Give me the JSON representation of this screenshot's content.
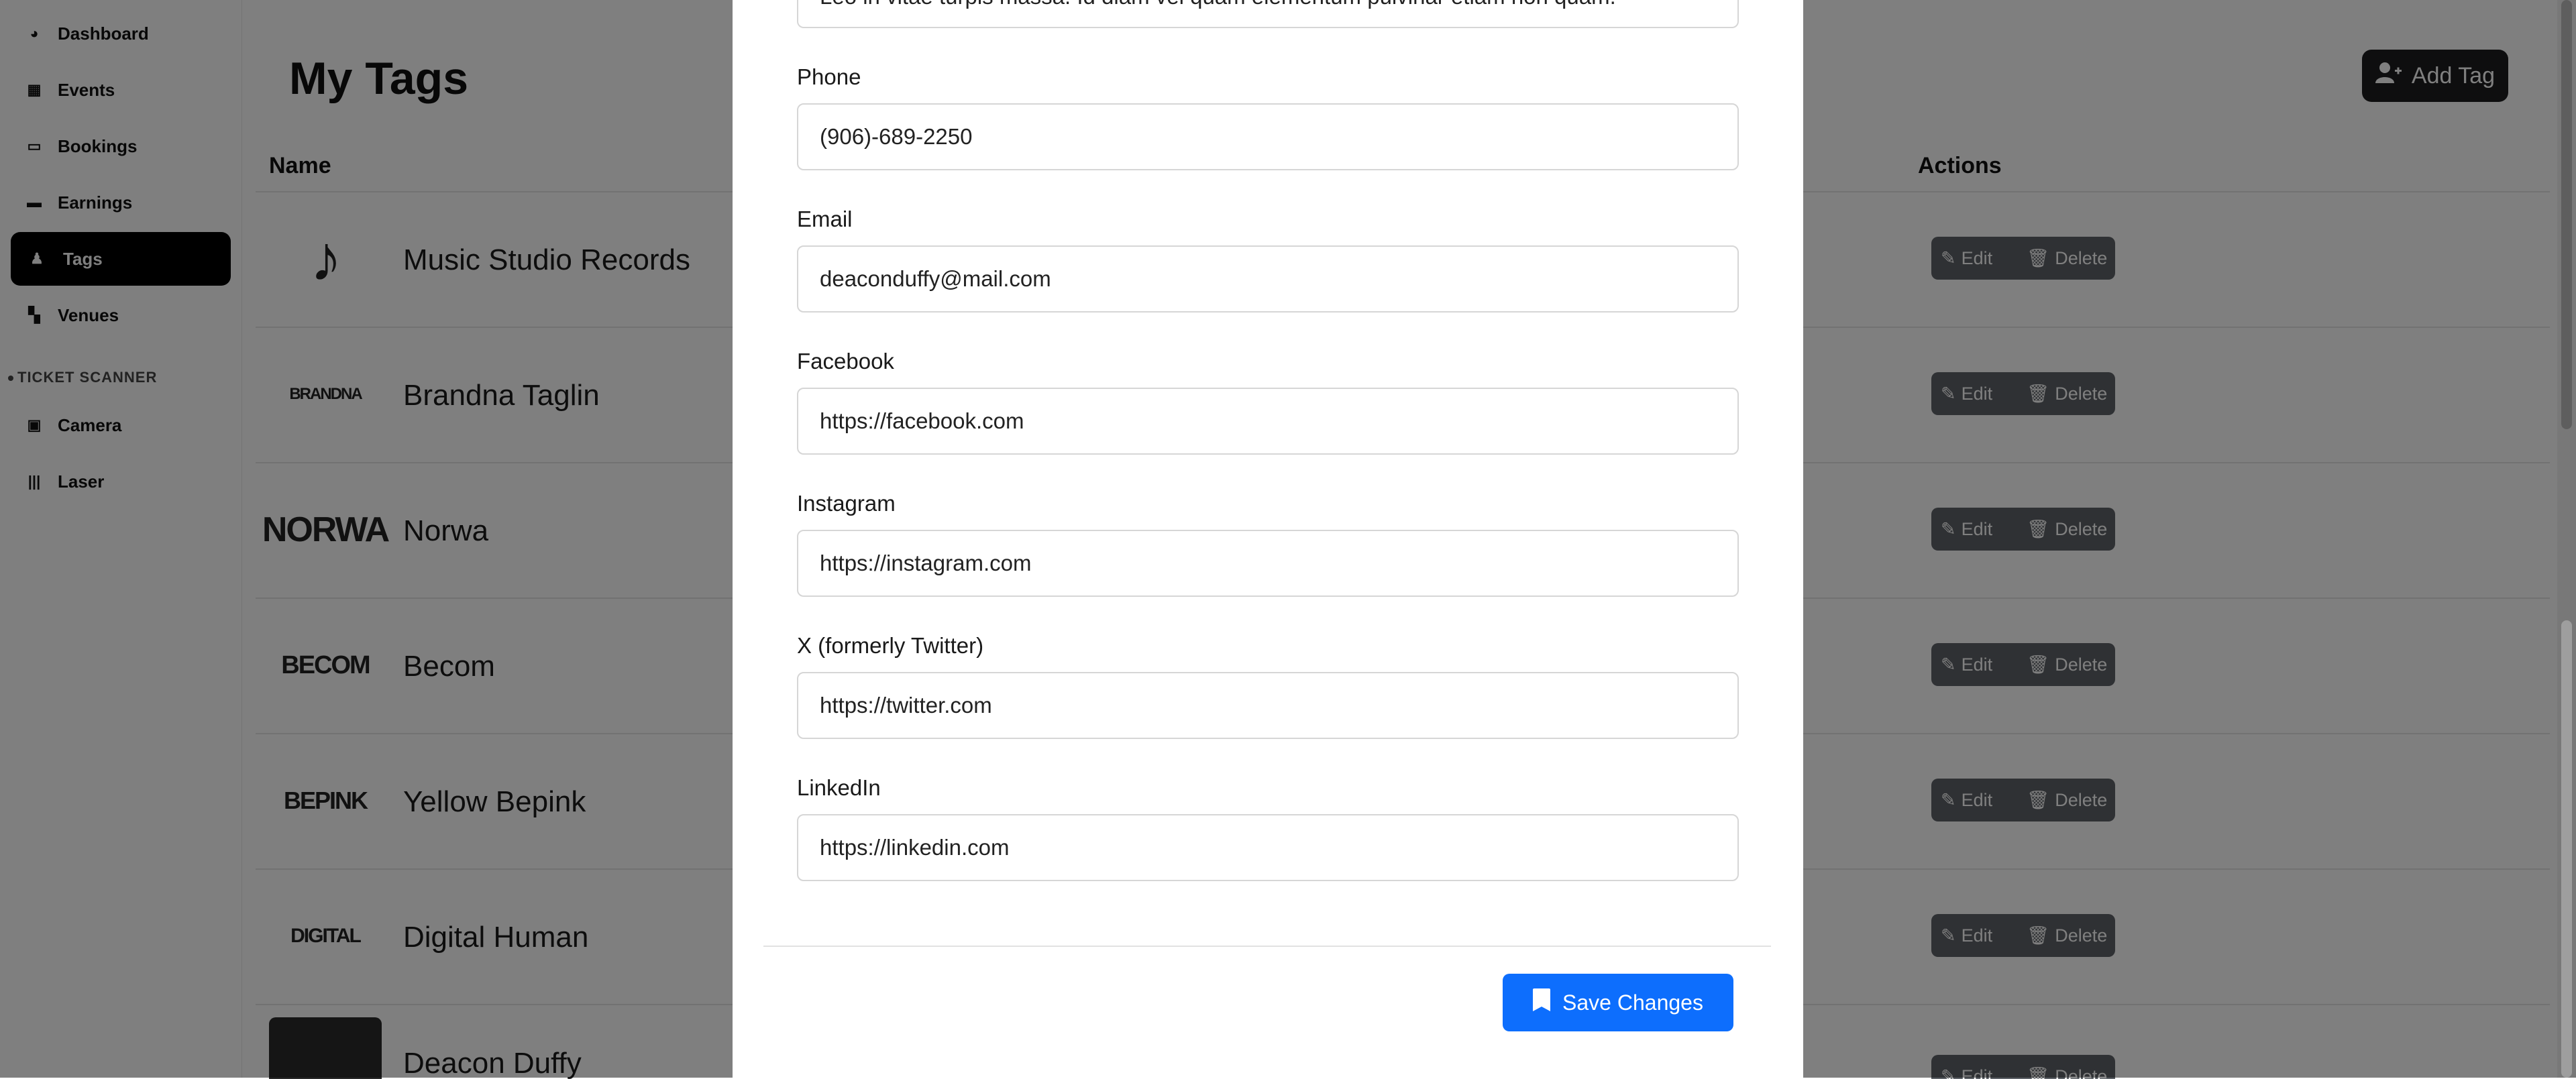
{
  "sidebar": {
    "items": [
      {
        "label": "Dashboard",
        "icon": "gauge-icon",
        "glyph": "◕"
      },
      {
        "label": "Events",
        "icon": "calendar-icon",
        "glyph": "▦"
      },
      {
        "label": "Bookings",
        "icon": "ticket-icon",
        "glyph": "▭"
      },
      {
        "label": "Earnings",
        "icon": "wallet-icon",
        "glyph": "▬"
      },
      {
        "label": "Tags",
        "icon": "user-tag-icon",
        "glyph": "♟"
      },
      {
        "label": "Venues",
        "icon": "map-icon",
        "glyph": "▚"
      }
    ],
    "section_label": "TICKET SCANNER",
    "scanner_items": [
      {
        "label": "Camera",
        "icon": "grid-icon",
        "glyph": "▣"
      },
      {
        "label": "Laser",
        "icon": "barcode-icon",
        "glyph": "|||"
      }
    ]
  },
  "main": {
    "title": "My Tags",
    "add_button": "Add Tag",
    "col_name": "Name",
    "col_actions": "Actions",
    "rows": [
      {
        "name": "Music Studio Records",
        "logo": "♪"
      },
      {
        "name": "Brandna Taglin",
        "logo": "BRANDNA"
      },
      {
        "name": "Norwa",
        "logo": "NORWA"
      },
      {
        "name": "Becom",
        "logo": "BECOM"
      },
      {
        "name": "Yellow Bepink",
        "logo": "BEPINK"
      },
      {
        "name": "Digital Human",
        "logo": "DIGITAL"
      },
      {
        "name": "Deacon Duffy",
        "logo": ""
      }
    ],
    "edit_label": "Edit",
    "delete_label": "Delete"
  },
  "modal": {
    "top_text": "Leo in vitae turpis massa. Id diam vel quam elementum pulvinar etiam non quam.",
    "fields": [
      {
        "label": "Phone",
        "value": "(906)-689-2250"
      },
      {
        "label": "Email",
        "value": "deaconduffy@mail.com"
      },
      {
        "label": "Facebook",
        "value": "https://facebook.com"
      },
      {
        "label": "Instagram",
        "value": "https://instagram.com"
      },
      {
        "label": "X (formerly Twitter)",
        "value": "https://twitter.com"
      },
      {
        "label": "LinkedIn",
        "value": "https://linkedin.com"
      }
    ],
    "save_button": "Save Changes"
  },
  "colors": {
    "primary": "#0d6efd",
    "overlay": "rgba(0,0,0,0.5)",
    "sidebar_active": "#000000"
  }
}
